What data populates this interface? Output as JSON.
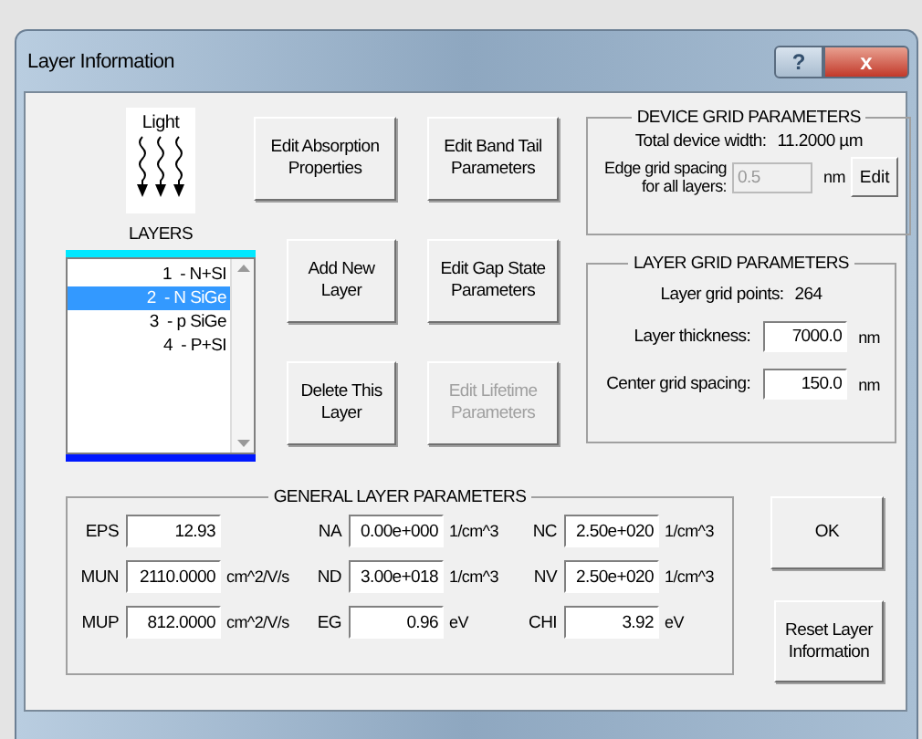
{
  "window": {
    "title": "Layer Information",
    "help_button": "?",
    "close_button": "x"
  },
  "light_icon": {
    "label": "Light"
  },
  "layers": {
    "label": "LAYERS",
    "items": [
      {
        "label": "1  - N+SI",
        "selected": false
      },
      {
        "label": "2  - N SiGe",
        "selected": true
      },
      {
        "label": "3  - p SiGe",
        "selected": false
      },
      {
        "label": "4  - P+SI",
        "selected": false
      }
    ]
  },
  "action_buttons": [
    {
      "label": "Edit Absorption Properties",
      "disabled": false
    },
    {
      "label": "Edit Band Tail Parameters",
      "disabled": false
    },
    {
      "label": "Add New Layer",
      "disabled": false
    },
    {
      "label": "Edit Gap State Parameters",
      "disabled": false
    },
    {
      "label": "Delete This Layer",
      "disabled": false
    },
    {
      "label": "Edit Lifetime Parameters",
      "disabled": true
    }
  ],
  "device_grid": {
    "title": "DEVICE GRID PARAMETERS",
    "total_label": "Total device width:",
    "total_value": "11.2000 µm",
    "edge_label": "Edge grid spacing for all layers:",
    "edge_value": "0.5",
    "edge_disabled": true,
    "edge_unit": "nm",
    "edit_button": "Edit"
  },
  "layer_grid": {
    "title": "LAYER GRID PARAMETERS",
    "points_label": "Layer grid points:",
    "points_value": "264",
    "fields": [
      {
        "label": "Layer thickness:",
        "value": "7000.0",
        "unit": "nm"
      },
      {
        "label": "Center grid spacing:",
        "value": "150.0",
        "unit": "nm"
      }
    ]
  },
  "general": {
    "title": "GENERAL LAYER PARAMETERS",
    "params": [
      {
        "label": "EPS",
        "value": "12.93"
      },
      {
        "label": "NA",
        "value": "0.00e+000",
        "unit": "1/cm^3"
      },
      {
        "label": "NC",
        "value": "2.50e+020",
        "unit": "1/cm^3"
      },
      {
        "label": "MUN",
        "value": "2110.0000",
        "unit": "cm^2/V/s"
      },
      {
        "label": "ND",
        "value": "3.00e+018",
        "unit": "1/cm^3"
      },
      {
        "label": "NV",
        "value": "2.50e+020",
        "unit": "1/cm^3"
      },
      {
        "label": "MUP",
        "value": "812.0000",
        "unit": "cm^2/V/s"
      },
      {
        "label": "EG",
        "value": "0.96",
        "unit": "eV"
      },
      {
        "label": "CHI",
        "value": "3.92",
        "unit": "eV"
      }
    ]
  },
  "ok_button": "OK",
  "reset_button": "Reset Layer Information"
}
